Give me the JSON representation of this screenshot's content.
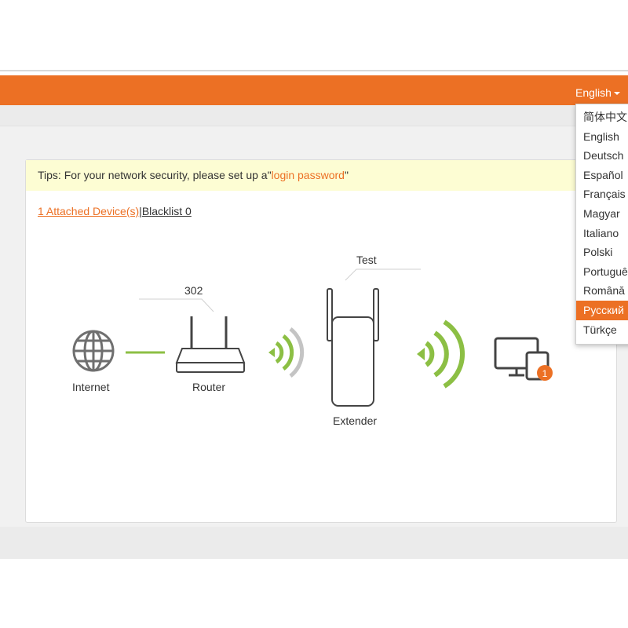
{
  "header": {
    "language_label": "English",
    "accent_color": "#ec7024"
  },
  "tips": {
    "prefix": "Tips: For your network security, please set up a\"",
    "link": "login password",
    "suffix": "\""
  },
  "devices": {
    "attached": "1 Attached Device(s)",
    "separator": "|",
    "blacklist": "Blacklist 0"
  },
  "topology": {
    "internet_label": "Internet",
    "router_label": "Router",
    "router_name": "302",
    "extender_label": "Extender",
    "extender_name": "Test",
    "client_badge": "1"
  },
  "language_menu": {
    "items": [
      "简体中文",
      "English",
      "Deutsch",
      "Español",
      "Français",
      "Magyar",
      "Italiano",
      "Polski",
      "Português",
      "Română",
      "Русский",
      "Türkçe"
    ],
    "selected": "Русский"
  }
}
